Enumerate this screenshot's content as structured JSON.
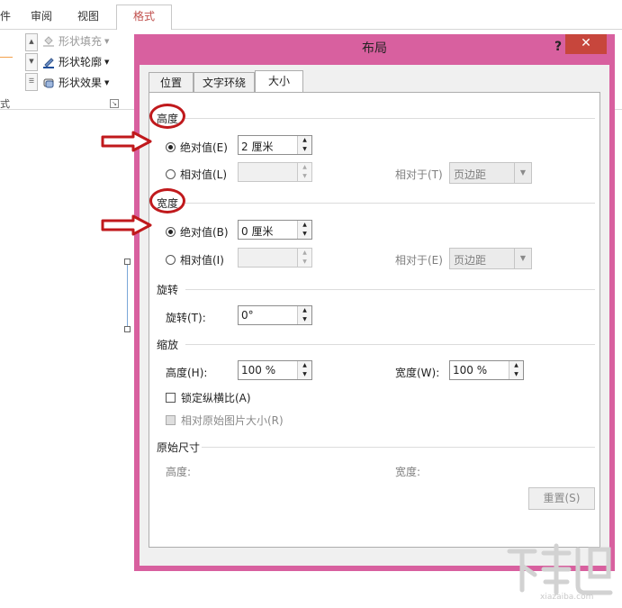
{
  "ribbon": {
    "tabs": [
      "件",
      "审阅",
      "视图",
      "格式"
    ],
    "items": [
      {
        "label": "形状填充",
        "enabled": false
      },
      {
        "label": "形状轮廓",
        "enabled": true
      },
      {
        "label": "形状效果",
        "enabled": true
      }
    ],
    "group_label": "式"
  },
  "dialog": {
    "title": "布局",
    "help": "?",
    "close": "✕",
    "tabs": [
      "位置",
      "文字环绕",
      "大小"
    ],
    "active_tab": "大小",
    "height": {
      "title": "高度",
      "absolute_label": "绝对值(E)",
      "absolute_value": "2 厘米",
      "relative_label": "相对值(L)",
      "relative_value": "",
      "relative_to_label": "相对于(T)",
      "relative_to_value": "页边距"
    },
    "width": {
      "title": "宽度",
      "absolute_label": "绝对值(B)",
      "absolute_value": "0 厘米",
      "relative_label": "相对值(I)",
      "relative_value": "",
      "relative_to_label": "相对于(E)",
      "relative_to_value": "页边距"
    },
    "rotation": {
      "title": "旋转",
      "label": "旋转(T):",
      "value": "0°"
    },
    "scale": {
      "title": "缩放",
      "height_label": "高度(H):",
      "height_value": "100 %",
      "width_label": "宽度(W):",
      "width_value": "100 %",
      "lock_aspect": "锁定纵横比(A)",
      "relative_original": "相对原始图片大小(R)"
    },
    "original": {
      "title": "原始尺寸",
      "height_label": "高度:",
      "width_label": "宽度:"
    },
    "reset": "重置(S)"
  },
  "watermark": {
    "text": "xiazaiba.com"
  },
  "colors": {
    "frame": "#d8609f",
    "close": "#c7463c",
    "annotation": "#c0191c",
    "format_tab": "#c0504d"
  }
}
